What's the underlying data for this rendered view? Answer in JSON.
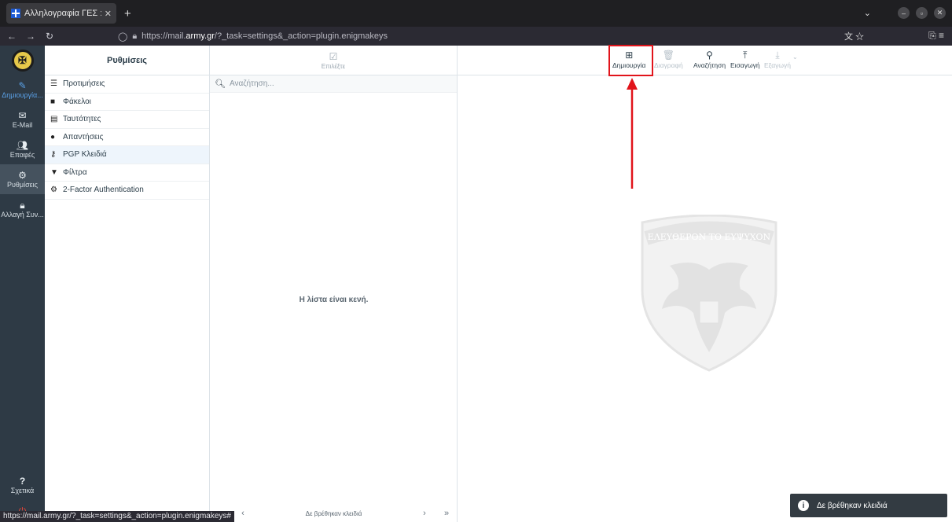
{
  "browser": {
    "tab_title": "Αλληλογραφία ΓΕΣ :: PGP",
    "url_prefix": "https://mail.",
    "url_host": "army.gr",
    "url_path": "/?_task=settings&_action=plugin.enigmakeys",
    "status_url": "https://mail.army.gr/?_task=settings&_action=plugin.enigmakeys#"
  },
  "rail": {
    "items": [
      {
        "label": "Δημιουργία..."
      },
      {
        "label": "E-Mail"
      },
      {
        "label": "Επαφές"
      },
      {
        "label": "Ρυθμίσεις"
      },
      {
        "label": "Αλλαγή Συν..."
      }
    ],
    "about_label": "Σχετικά"
  },
  "settings": {
    "title": "Ρυθμίσεις",
    "items": [
      {
        "label": "Προτιμήσεις"
      },
      {
        "label": "Φάκελοι"
      },
      {
        "label": "Ταυτότητες"
      },
      {
        "label": "Απαντήσεις"
      },
      {
        "label": "PGP Κλειδιά"
      },
      {
        "label": "Φίλτρα"
      },
      {
        "label": "2-Factor Authentication"
      }
    ]
  },
  "keys": {
    "select_label": "Επιλέξτε",
    "search_placeholder": "Αναζήτηση...",
    "empty_text": "Η λίστα είναι κενή.",
    "pager_text": "Δε βρέθηκαν κλειδιά"
  },
  "toolbar": {
    "create": "Δημιουργία",
    "delete": "Διαγραφή",
    "search": "Αναζήτηση",
    "import": "Εισαγωγή",
    "export": "Εξαγωγή"
  },
  "watermark_text": "ΕΛΕΥΘΕΡΟΝ ΤΟ ΕΥΨΥΧΟΝ",
  "toast": {
    "text": "Δε βρέθηκαν κλειδιά"
  },
  "colors": {
    "highlight": "#e1141b",
    "rail": "#2e3a45",
    "accent": "#5aa0e6"
  }
}
